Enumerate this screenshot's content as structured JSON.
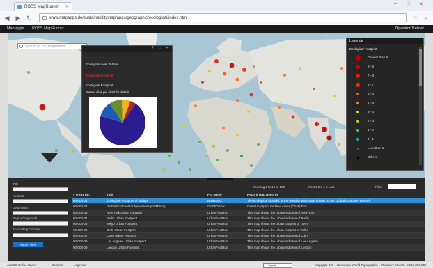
{
  "browser": {
    "tab_title": "ROSS MapRunner",
    "url": "www.mapapps.de/sustainabilitymap/apps/geographic/ecological/index.html"
  },
  "app": {
    "brand": "Map apps",
    "title": "ROSS MapRunner",
    "user_links": [
      "Operator",
      "Builder"
    ]
  },
  "map": {
    "search_placeholder": "Search ROSS MapRunner"
  },
  "popup": {
    "line1": "Ecological over: Tabaya",
    "line2_red": "Ecological Footprint",
    "line3": "Ecological Footprint",
    "line4": "Please click pie chart for details"
  },
  "chart_data": {
    "type": "pie",
    "values": [
      70,
      11,
      9,
      6,
      4
    ],
    "colors": [
      "#2b1c8f",
      "#1f5bb5",
      "#6a8f2a",
      "#f2b21a",
      "#b02a1a"
    ]
  },
  "legend": {
    "title": "Legende",
    "subtitle": "Ecological Footprint",
    "items": [
      {
        "label": "Greater than 9",
        "color": "#b00000",
        "size": 4
      },
      {
        "label": "8 - 9",
        "color": "#c80000",
        "size": 3.4
      },
      {
        "label": "7 - 8",
        "color": "#d81b10",
        "size": 3
      },
      {
        "label": "6 - 7",
        "color": "#e0301a",
        "size": 2.7
      },
      {
        "label": "5 - 6",
        "color": "#e8552a",
        "size": 2.4
      },
      {
        "label": "4 - 5",
        "color": "#ef7a2e",
        "size": 2.2
      },
      {
        "label": "3 - 4",
        "color": "#d8d020",
        "size": 2
      },
      {
        "label": "2 - 3",
        "color": "#a8c830",
        "size": 1.8
      },
      {
        "label": "1 - 2",
        "color": "#4cb04a",
        "size": 1.7
      },
      {
        "label": "0 - 1",
        "color": "#2a9a7a",
        "size": 1.6
      },
      {
        "label": "Less than 1",
        "color": "#1a6aa0",
        "size": 1.5
      },
      {
        "label": "Others",
        "color": "#000000",
        "size": 1.5
      }
    ]
  },
  "form": {
    "labels": [
      "Title",
      "Abstract",
      "Description",
      "Region/Keywords",
      "Accounting Concept"
    ],
    "search_button": "Apply Filter"
  },
  "table_tools": {
    "showing": "Showing 1 to 10 of 102",
    "pager": "First  1  2  3  4  5  Last",
    "search_label": "Filter"
  },
  "table": {
    "headers": [
      "# entity no.",
      "Title",
      "Put Name",
      "Record Map Records"
    ],
    "rows": [
      [
        "00-004-01",
        "Ecological Footprint of Tabaya",
        "BoundSIG",
        "The ecological footprint of the world's nations are shown on the Global Footprint Network"
      ],
      [
        "00-004-02",
        "Global Footprint for New Areas (OSM tool)",
        "GlobFOSSY",
        "Global Footprint for New Areas (OSM) Tool"
      ],
      [
        "00-004-03",
        "New York Urban Footprint",
        "UrbanFootRun",
        "This map shows the urbanized area of New York"
      ],
      [
        "00-004-04",
        "Berlin Urban Footprint",
        "UrbanFootRun",
        "This map shows the urbanized area of Berlin"
      ],
      [
        "00-004-05",
        "Tokyo Urban Footprint",
        "UrbanFootRun",
        "This map shows the urban footprint of Tokyo"
      ],
      [
        "00-004-06",
        "Delhi Urban Footprint",
        "UrbanFootRun",
        "This map shows the urban footprint of Delhi"
      ],
      [
        "00-004-07",
        "Cairo Urban Footprint",
        "UrbanFootRun",
        "This map shows the urbanized area of Cairo"
      ],
      [
        "00-004-08",
        "Los Angeles Urban Footprint",
        "UrbanFootRun",
        "This map shows the urbanized area of Los Angeles"
      ],
      [
        "00-004-09",
        "London Urban Footprint",
        "UrbanFootRun",
        "This map shows the urbanized area of London"
      ]
    ]
  },
  "statusbar": {
    "left": [
      "ArcGIS Online Kamo",
      "Controls",
      "Legende"
    ],
    "mid": "Spatial",
    "right": [
      "mapapps 3.0",
      "Basemap: World Topographic",
      "Rotation: 0",
      "Scale: 1:147,000,000"
    ]
  }
}
